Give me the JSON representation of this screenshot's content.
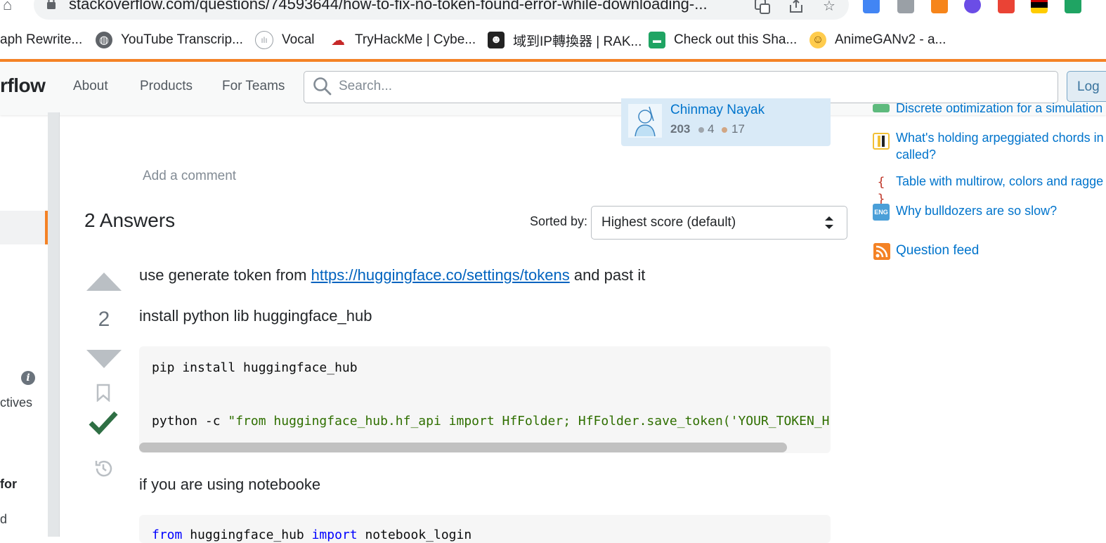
{
  "browser": {
    "url": "stackoverflow.com/questions/74593644/how-to-fix-no-token-found-error-while-downloading-...",
    "bookmarks": [
      {
        "label": "aph Rewrite..."
      },
      {
        "label": "YouTube Transcrip..."
      },
      {
        "label": "Vocal"
      },
      {
        "label": "TryHackMe | Cybe..."
      },
      {
        "label": "域到IP轉換器 | RAK..."
      },
      {
        "label": "Check out this Sha..."
      },
      {
        "label": "AnimeGANv2 - a..."
      }
    ]
  },
  "topbar": {
    "logo": "rflow",
    "nav": [
      "About",
      "Products",
      "For Teams"
    ],
    "search_placeholder": "Search...",
    "login": "Log"
  },
  "sidebar_left": {
    "text_ctives": "ctives",
    "text_for": "for",
    "text_d": "d"
  },
  "author": {
    "name": "Chinmay Nayak",
    "rep": "203",
    "silver": "4",
    "bronze": "17"
  },
  "comments": {
    "add": "Add a comment"
  },
  "answers": {
    "header": "2 Answers",
    "sorted_by": "Sorted by:",
    "sort_value": "Highest score (default)"
  },
  "answer1": {
    "score": "2",
    "p1_before": "use generate token from ",
    "p1_link": "https://huggingface.co/settings/tokens",
    "p1_after": " and past it",
    "p2": "install python lib huggingface_hub",
    "code_line1": "pip install huggingface_hub",
    "code_line2_cmd": "python -c ",
    "code_line2_str": "\"from huggingface_hub.hf_api import HfFolder; HfFolder.save_token('YOUR_TOKEN_HERE')\"",
    "p3": "if you are using notebooke",
    "code2_kw1": "from",
    "code2_mid": " huggingface_hub ",
    "code2_kw2": "import",
    "code2_end": " notebook_login"
  },
  "sidebar_right": {
    "hot_top": "Discrete optimization for a simulation",
    "hot": [
      {
        "line1": "What's holding arpeggiated chords in",
        "line2": "called?"
      },
      {
        "line1": "Table with multirow, colors and ragge"
      },
      {
        "line1": "Why bulldozers are so slow?"
      }
    ],
    "feed": "Question feed"
  },
  "colors": {
    "accent": "#f48225",
    "link": "#0074cc",
    "accepted": "#2f6f44"
  }
}
